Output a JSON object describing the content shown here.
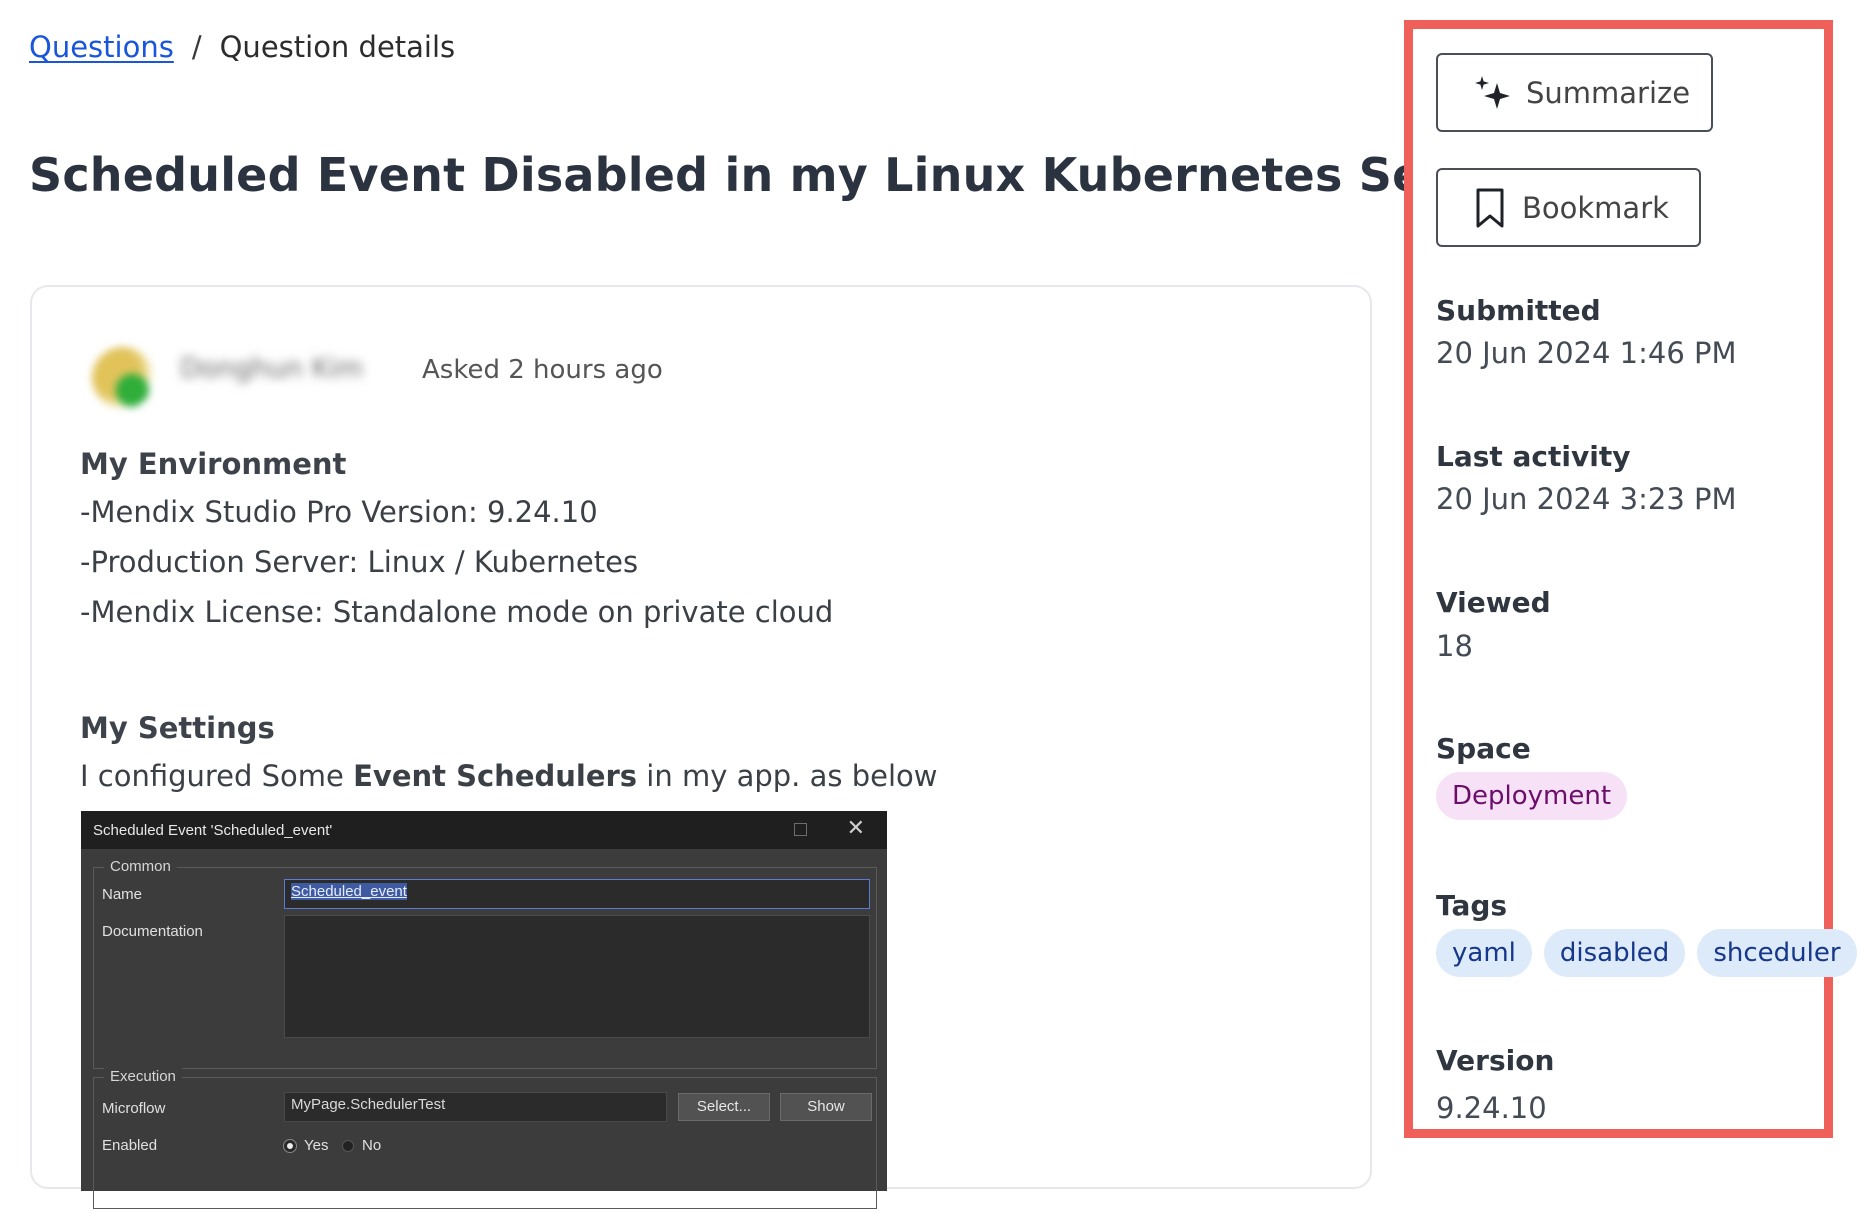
{
  "breadcrumb": {
    "link": "Questions",
    "separator": "/",
    "current": "Question details"
  },
  "title": "Scheduled Event Disabled in my Linux Kubernetes Server",
  "post": {
    "author": "Donghun Kim",
    "asked": "Asked 2 hours ago",
    "env_heading": "My Environment",
    "env_lines": [
      "-Mendix Studio Pro Version: 9.24.10",
      "-Production Server: Linux / Kubernetes",
      "-Mendix License: Standalone mode on private cloud"
    ],
    "settings_heading": "My Settings",
    "settings_pre": "I configured Some ",
    "settings_bold": "Event Schedulers",
    "settings_post": " in my app. as below"
  },
  "dialog": {
    "title": "Scheduled Event 'Scheduled_event'",
    "common_legend": "Common",
    "name_label": "Name",
    "name_value": "Scheduled_event",
    "doc_label": "Documentation",
    "execution_legend": "Execution",
    "microflow_label": "Microflow",
    "microflow_value": "MyPage.SchedulerTest",
    "select_button": "Select...",
    "show_button": "Show",
    "enabled_label": "Enabled",
    "yes": "Yes",
    "no": "No"
  },
  "sidebar": {
    "summarize": "Summarize",
    "bookmark": "Bookmark",
    "submitted_label": "Submitted",
    "submitted_value": "20 Jun 2024 1:46 PM",
    "last_activity_label": "Last activity",
    "last_activity_value": "20 Jun 2024 3:23 PM",
    "viewed_label": "Viewed",
    "viewed_value": "18",
    "space_label": "Space",
    "space_value": "Deployment",
    "tags_label": "Tags",
    "tags": [
      "yaml",
      "disabled",
      "shceduler"
    ],
    "version_label": "Version",
    "version_value": "9.24.10"
  },
  "colors": {
    "link": "#1a56db",
    "highlight_border": "#f0605a",
    "space_chip_bg": "#f7e1f7",
    "tag_chip_bg": "#dceafa"
  },
  "icons": {
    "summarize": "sparkles-icon",
    "bookmark": "bookmark-icon",
    "close": "close-icon"
  }
}
